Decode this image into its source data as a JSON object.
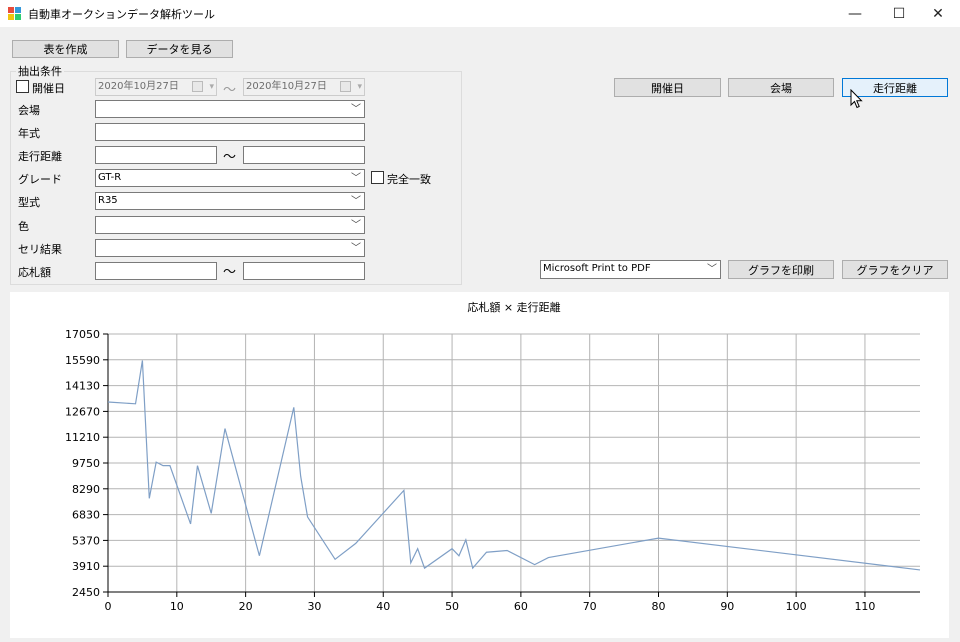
{
  "window": {
    "title": "自動車オークションデータ解析ツール",
    "min_glyph": "—",
    "max_glyph": "☐",
    "close_glyph": "✕"
  },
  "toolbar": {
    "create_table": "表を作成",
    "view_data": "データを見る"
  },
  "conditions": {
    "group_title": "抽出条件",
    "date": {
      "label": "開催日",
      "checked": false,
      "from": "2020年10月27日",
      "to": "2020年10月27日",
      "separator": "～"
    },
    "venue": {
      "label": "会場",
      "value": ""
    },
    "year": {
      "label": "年式",
      "value": ""
    },
    "mileage": {
      "label": "走行距離",
      "from": "",
      "to": "",
      "separator": "～"
    },
    "grade": {
      "label": "グレード",
      "value": "GT-R"
    },
    "exact_match": {
      "label": "完全一致",
      "checked": false
    },
    "model": {
      "label": "型式",
      "value": "R35"
    },
    "color": {
      "label": "色",
      "value": ""
    },
    "auction_result": {
      "label": "セリ結果",
      "value": ""
    },
    "bid_amount": {
      "label": "応札額",
      "from": "",
      "to": "",
      "separator": "～"
    }
  },
  "axis_buttons": {
    "date": "開催日",
    "venue": "会場",
    "mileage": "走行距離",
    "selected": "mileage"
  },
  "printer": {
    "selected": "Microsoft Print to PDF",
    "print_button": "グラフを印刷",
    "clear_button": "グラフをクリア"
  },
  "colors": {
    "series": "#7f9fc6",
    "selected_button_border": "#0078d7"
  },
  "chart_data": {
    "type": "line",
    "title": "応札額 × 走行距離",
    "xlim": [
      0,
      118
    ],
    "ylim": [
      2450,
      17050
    ],
    "xticks": [
      0,
      10,
      20,
      30,
      40,
      50,
      60,
      70,
      80,
      90,
      100,
      110
    ],
    "yticks": [
      2450,
      3910,
      5370,
      6830,
      8290,
      9750,
      11210,
      12670,
      14130,
      15590,
      17050
    ],
    "grid": true,
    "series": [
      {
        "x": [
          0,
          4,
          5,
          6,
          7,
          8,
          9,
          12,
          13,
          15,
          17,
          22,
          27,
          28,
          29,
          33,
          36,
          43,
          44,
          45,
          46,
          50,
          51,
          52,
          53,
          55,
          58,
          62,
          64,
          80,
          118
        ],
        "y": [
          13200,
          13100,
          15550,
          7750,
          9800,
          9600,
          9600,
          6300,
          9600,
          6900,
          11700,
          4500,
          12900,
          9000,
          6700,
          4300,
          5200,
          8200,
          4100,
          4900,
          3800,
          4900,
          4500,
          5400,
          3800,
          4700,
          4800,
          4000,
          4400,
          5500,
          3700
        ]
      }
    ]
  }
}
